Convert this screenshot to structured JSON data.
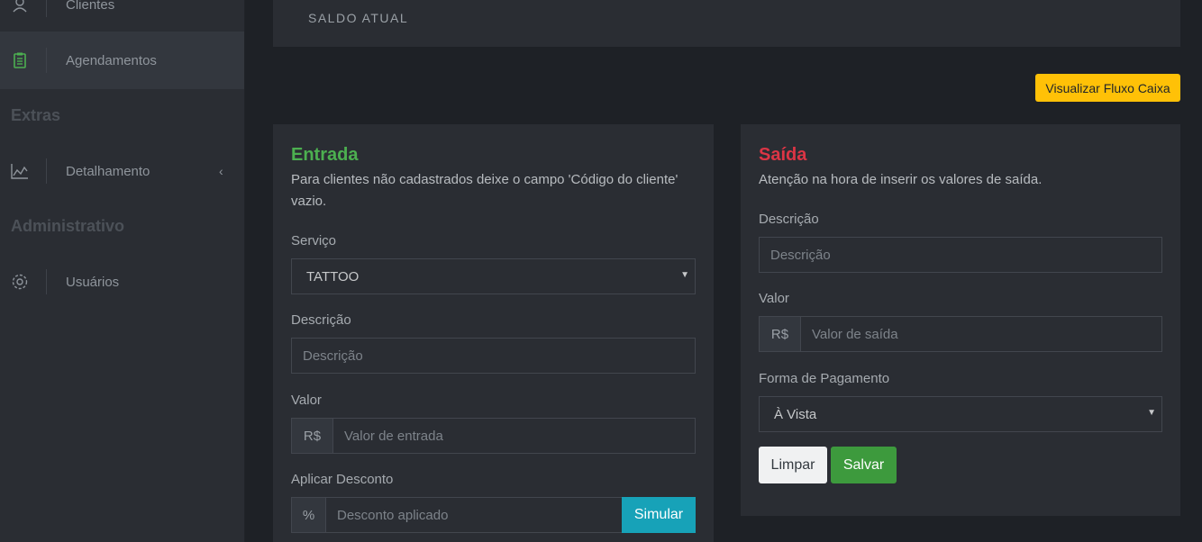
{
  "sidebar": {
    "items": [
      {
        "label": "Clientes",
        "icon": "user-icon"
      },
      {
        "label": "Agendamentos",
        "icon": "clipboard-icon"
      },
      {
        "label": "Detalhamento",
        "icon": "chart-line-icon"
      },
      {
        "label": "Usuários",
        "icon": "gear-icon"
      }
    ],
    "section_extras": "Extras",
    "section_admin": "Administrativo"
  },
  "top": {
    "subtitle": "SALDO ATUAL",
    "flux_button": "Visualizar Fluxo Caixa"
  },
  "entrada": {
    "title": "Entrada",
    "desc": "Para clientes não cadastrados deixe o campo 'Código do cliente' vazio.",
    "servico_label": "Serviço",
    "servico_value": "TATTOO",
    "descricao_label": "Descrição",
    "descricao_placeholder": "Descrição",
    "valor_label": "Valor",
    "currency": "R$",
    "valor_placeholder": "Valor de entrada",
    "desconto_label": "Aplicar Desconto",
    "percent": "%",
    "desconto_placeholder": "Desconto aplicado",
    "simular": "Simular"
  },
  "saida": {
    "title": "Saída",
    "desc": "Atenção na hora de inserir os valores de saída.",
    "descricao_label": "Descrição",
    "descricao_placeholder": "Descrição",
    "valor_label": "Valor",
    "currency": "R$",
    "valor_placeholder": "Valor de saída",
    "pagamento_label": "Forma de Pagamento",
    "pagamento_value": "À Vista",
    "limpar": "Limpar",
    "salvar": "Salvar"
  },
  "colors": {
    "entrada_title": "#4caf50",
    "saida_title": "#dc3545",
    "active_icon": "#4caf50",
    "warning": "#ffc107",
    "info": "#17a2b8",
    "success": "#3d9a3d"
  }
}
